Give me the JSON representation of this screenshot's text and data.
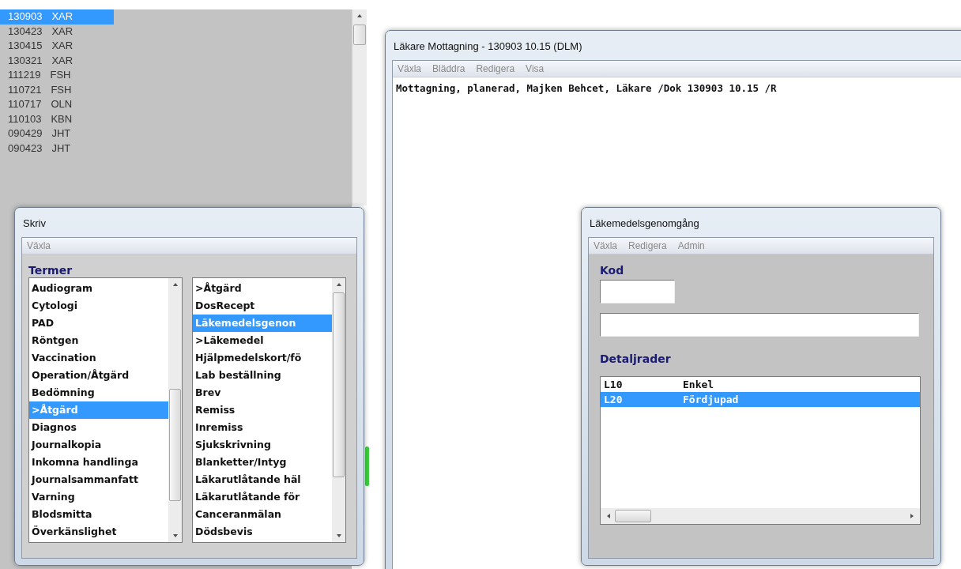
{
  "record_list": {
    "rows": [
      {
        "date": "130903",
        "code": "XAR",
        "selected": true
      },
      {
        "date": "130423",
        "code": "XAR",
        "selected": false
      },
      {
        "date": "130415",
        "code": "XAR",
        "selected": false
      },
      {
        "date": "130321",
        "code": "XAR",
        "selected": false
      },
      {
        "date": "111219",
        "code": "FSH",
        "selected": false
      },
      {
        "date": "110721",
        "code": "FSH",
        "selected": false
      },
      {
        "date": "110717",
        "code": "OLN",
        "selected": false
      },
      {
        "date": "110103",
        "code": "KBN",
        "selected": false
      },
      {
        "date": "090429",
        "code": "JHT",
        "selected": false
      },
      {
        "date": "090423",
        "code": "JHT",
        "selected": false
      }
    ]
  },
  "main_window": {
    "title": "Läkare Mottagning - 130903 10.15  (DLM)",
    "menu": [
      "Växla",
      "Bläddra",
      "Redigera",
      "Visa"
    ],
    "text": "Mottagning, planerad, Majken Behcet, Läkare /Dok 130903 10.15 /R"
  },
  "write_window": {
    "title": "Skriv",
    "menu": [
      "Växla"
    ],
    "heading": "Termer",
    "lists": [
      {
        "items": [
          {
            "label": "Audiogram",
            "selected": false
          },
          {
            "label": "Cytologi",
            "selected": false
          },
          {
            "label": "PAD",
            "selected": false
          },
          {
            "label": "Röntgen",
            "selected": false
          },
          {
            "label": "Vaccination",
            "selected": false
          },
          {
            "label": "Operation/Åtgärd",
            "selected": false
          },
          {
            "label": "Bedömning",
            "selected": false
          },
          {
            "label": ">Åtgärd",
            "selected": true
          },
          {
            "label": "Diagnos",
            "selected": false
          },
          {
            "label": "Journalkopia",
            "selected": false
          },
          {
            "label": "Inkomna handlinga",
            "selected": false
          },
          {
            "label": "Journalsammanfatt",
            "selected": false
          },
          {
            "label": "Varning",
            "selected": false
          },
          {
            "label": "Blodsmitta",
            "selected": false
          },
          {
            "label": "Överkänslighet",
            "selected": false
          }
        ]
      },
      {
        "items": [
          {
            "label": ">Åtgärd",
            "selected": false
          },
          {
            "label": "DosRecept",
            "selected": false
          },
          {
            "label": "Läkemedelsgenon",
            "selected": true
          },
          {
            "label": ">Läkemedel",
            "selected": false
          },
          {
            "label": "Hjälpmedelskort/fö",
            "selected": false
          },
          {
            "label": "Lab beställning",
            "selected": false
          },
          {
            "label": "Brev",
            "selected": false
          },
          {
            "label": "Remiss",
            "selected": false
          },
          {
            "label": "Inremiss",
            "selected": false
          },
          {
            "label": "Sjukskrivning",
            "selected": false
          },
          {
            "label": "Blanketter/Intyg",
            "selected": false
          },
          {
            "label": "Läkarutlåtande häl",
            "selected": false
          },
          {
            "label": "Läkarutlåtande för",
            "selected": false
          },
          {
            "label": "Canceranmälan",
            "selected": false
          },
          {
            "label": "Dödsbevis",
            "selected": false
          }
        ]
      }
    ]
  },
  "review_window": {
    "title": "Läkemedelsgenomgång",
    "menu": [
      "Växla",
      "Redigera",
      "Admin"
    ],
    "code_label": "Kod",
    "details_label": "Detaljrader",
    "detail_rows": [
      {
        "code": "L10",
        "text": "Enkel",
        "selected": false
      },
      {
        "code": "L20",
        "text": "Fördjupad",
        "selected": true
      }
    ]
  }
}
